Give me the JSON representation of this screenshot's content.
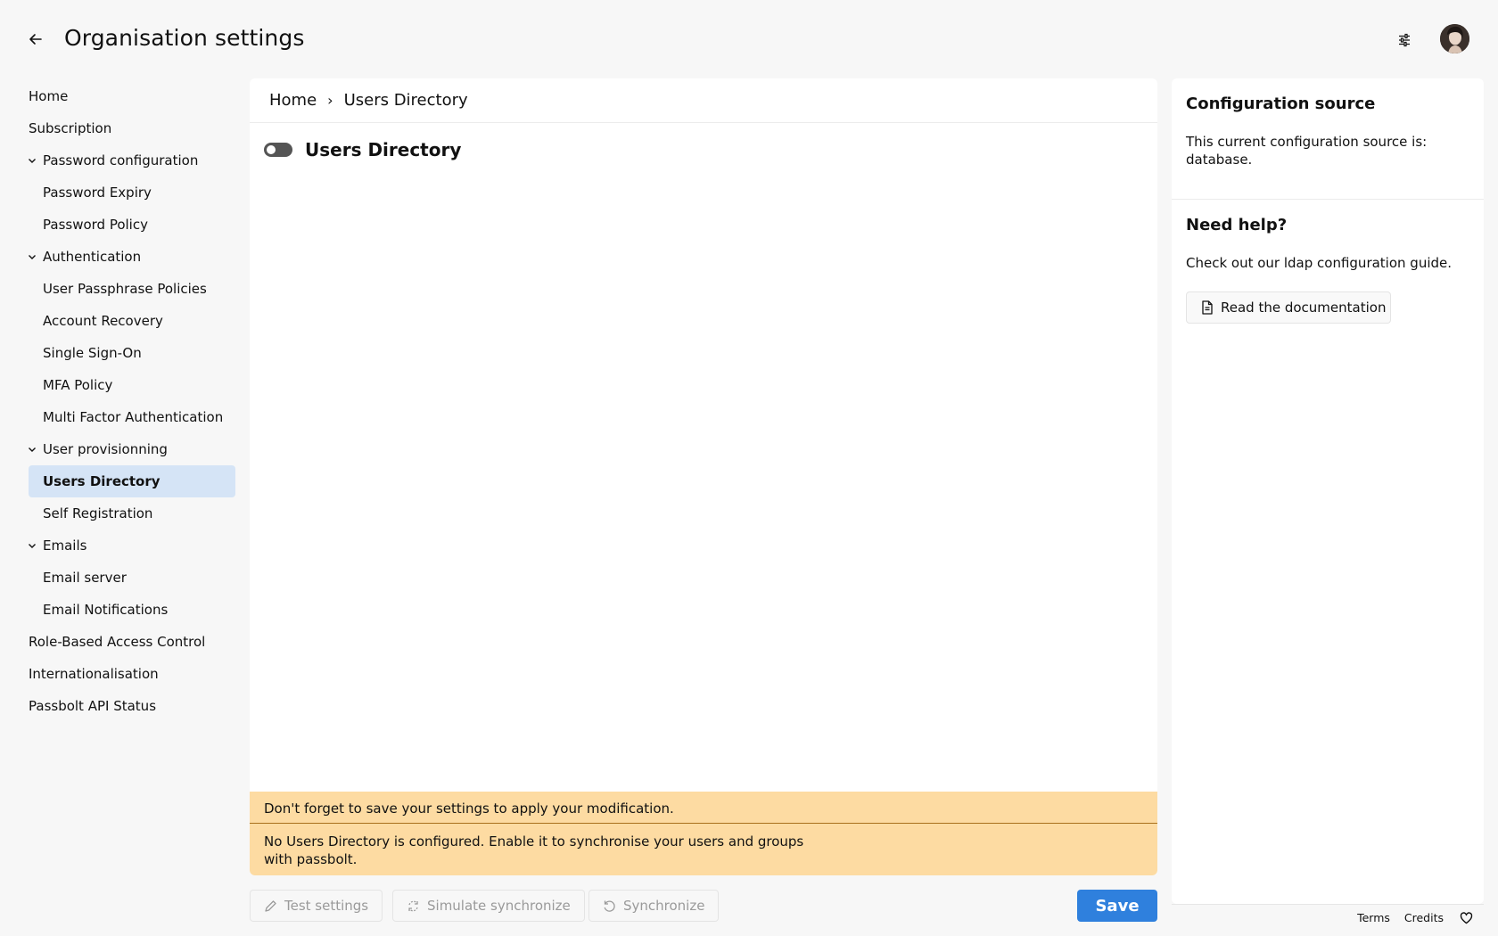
{
  "header": {
    "title": "Organisation settings"
  },
  "sidebar": {
    "items": [
      {
        "label": "Home"
      },
      {
        "label": "Subscription"
      },
      {
        "label": "Password configuration"
      },
      {
        "label": "Password Expiry"
      },
      {
        "label": "Password Policy"
      },
      {
        "label": "Authentication"
      },
      {
        "label": "User Passphrase Policies"
      },
      {
        "label": "Account Recovery"
      },
      {
        "label": "Single Sign-On"
      },
      {
        "label": "MFA Policy"
      },
      {
        "label": "Multi Factor Authentication"
      },
      {
        "label": "User provisionning"
      },
      {
        "label": "Users Directory"
      },
      {
        "label": "Self Registration"
      },
      {
        "label": "Emails"
      },
      {
        "label": "Email server"
      },
      {
        "label": "Email Notifications"
      },
      {
        "label": "Role-Based Access Control"
      },
      {
        "label": "Internationalisation"
      },
      {
        "label": "Passbolt API Status"
      }
    ]
  },
  "breadcrumb": {
    "home": "Home",
    "separator": "›",
    "current": "Users Directory"
  },
  "main": {
    "section_title": "Users Directory",
    "toggle_enabled": false,
    "warning_save": "Don't forget to save your settings to apply your modification.",
    "warning_not_configured": "No Users Directory is configured. Enable it to synchronise your users and groups with passbolt."
  },
  "actions": {
    "test_label": "Test settings",
    "simulate_label": "Simulate synchronize",
    "synchronize_label": "Synchronize",
    "save_label": "Save"
  },
  "right_panel": {
    "config_title": "Configuration source",
    "config_text": "This current configuration source is: database.",
    "help_title": "Need help?",
    "help_text": "Check out our ldap configuration guide.",
    "doc_button": "Read the documentation"
  },
  "footer": {
    "terms": "Terms",
    "credits": "Credits"
  },
  "colors": {
    "accent": "#2f80dd",
    "selected_bg": "#d5e4f6",
    "warning_bg": "#fddba2"
  }
}
